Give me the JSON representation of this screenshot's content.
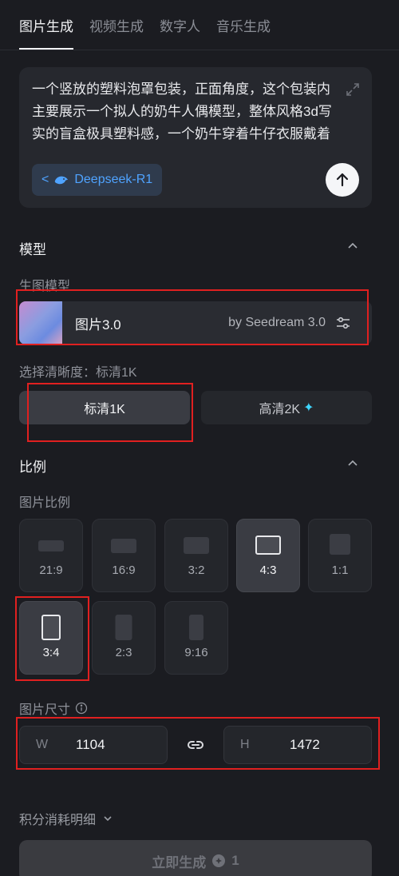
{
  "tabs": [
    {
      "label": "图片生成",
      "active": true
    },
    {
      "label": "视频生成",
      "active": false
    },
    {
      "label": "数字人",
      "active": false
    },
    {
      "label": "音乐生成",
      "active": false
    }
  ],
  "prompt": {
    "text": "一个竖放的塑料泡罩包装，正面角度，这个包装内主要展示一个拟人的奶牛人偶模型，整体风格3d写实的盲盒极具塑料感，一个奶牛穿着牛仔衣服戴着工牌抱着电脑戴着蓝色口罩，头顶圆光",
    "model_chip": "Deepseek-R1"
  },
  "model_section": {
    "title": "模型",
    "sub_label": "生图模型",
    "model_name": "图片3.0",
    "model_by": "by Seedream 3.0",
    "resolution_label": "选择清晰度：标清1K",
    "res_options": [
      "标清1K",
      "高清2K"
    ],
    "res_selected": "标清1K"
  },
  "ratio_section": {
    "title": "比例",
    "sub_label": "图片比例",
    "options": [
      "21:9",
      "16:9",
      "3:2",
      "4:3",
      "1:1",
      "3:4",
      "2:3",
      "9:16"
    ],
    "selected": "3:4"
  },
  "size_section": {
    "label": "图片尺寸",
    "w_label": "W",
    "w_value": "1104",
    "h_label": "H",
    "h_value": "1472"
  },
  "cost_label": "积分消耗明细",
  "generate": {
    "label": "立即生成",
    "cost": "1"
  },
  "colors": {
    "background": "#1b1c21",
    "accent_blue": "#4fa3ff",
    "annotation_red": "#e02020"
  }
}
